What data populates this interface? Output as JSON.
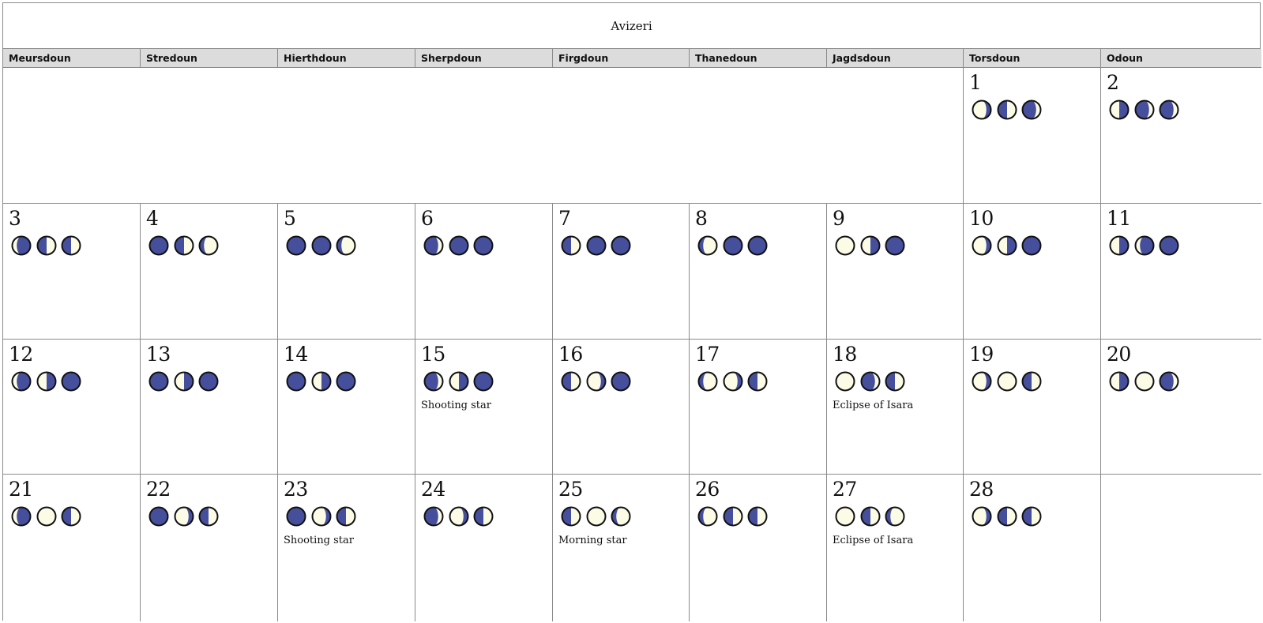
{
  "calendar": {
    "month": "Avizeri",
    "weekdays": [
      "Meursdoun",
      "Stredoun",
      "Hierthdoun",
      "Sherpdoun",
      "Firgdoun",
      "Thanedoun",
      "Jagdsdoun",
      "Torsdoun",
      "Odoun"
    ],
    "moon_colors": {
      "dark": "#454f9c",
      "light": "#fcfbe5",
      "outline": "#111111"
    },
    "moon_phase_encoding": [
      "new",
      "waxing-crescent",
      "first-quarter",
      "waxing-gibbous",
      "full",
      "waning-gibbous",
      "last-quarter",
      "waning-crescent"
    ],
    "days": [
      {
        "day": "1",
        "col": 7,
        "row": 0,
        "moons": [
          "waning-gibbous",
          "first-quarter",
          "waxing-crescent"
        ],
        "event": ""
      },
      {
        "day": "2",
        "col": 8,
        "row": 0,
        "moons": [
          "last-quarter",
          "waxing-crescent",
          "waxing-crescent"
        ],
        "event": ""
      },
      {
        "day": "3",
        "col": 0,
        "row": 1,
        "moons": [
          "waning-crescent",
          "first-quarter",
          "first-quarter"
        ],
        "event": ""
      },
      {
        "day": "4",
        "col": 1,
        "row": 1,
        "moons": [
          "new",
          "first-quarter",
          "waxing-gibbous"
        ],
        "event": ""
      },
      {
        "day": "5",
        "col": 2,
        "row": 1,
        "moons": [
          "new",
          "new",
          "waxing-gibbous"
        ],
        "event": ""
      },
      {
        "day": "6",
        "col": 3,
        "row": 1,
        "moons": [
          "waxing-crescent",
          "new",
          "new"
        ],
        "event": ""
      },
      {
        "day": "7",
        "col": 4,
        "row": 1,
        "moons": [
          "first-quarter",
          "new",
          "new"
        ],
        "event": ""
      },
      {
        "day": "8",
        "col": 5,
        "row": 1,
        "moons": [
          "waxing-gibbous",
          "new",
          "new"
        ],
        "event": ""
      },
      {
        "day": "9",
        "col": 6,
        "row": 1,
        "moons": [
          "full",
          "last-quarter",
          "new"
        ],
        "event": ""
      },
      {
        "day": "10",
        "col": 7,
        "row": 1,
        "moons": [
          "waning-gibbous",
          "last-quarter",
          "new"
        ],
        "event": ""
      },
      {
        "day": "11",
        "col": 8,
        "row": 1,
        "moons": [
          "last-quarter",
          "waning-crescent",
          "new"
        ],
        "event": ""
      },
      {
        "day": "12",
        "col": 0,
        "row": 2,
        "moons": [
          "waning-crescent",
          "last-quarter",
          "new"
        ],
        "event": ""
      },
      {
        "day": "13",
        "col": 1,
        "row": 2,
        "moons": [
          "new",
          "last-quarter",
          "new"
        ],
        "event": ""
      },
      {
        "day": "14",
        "col": 2,
        "row": 2,
        "moons": [
          "new",
          "last-quarter",
          "new"
        ],
        "event": ""
      },
      {
        "day": "15",
        "col": 3,
        "row": 2,
        "moons": [
          "waxing-crescent",
          "last-quarter",
          "new"
        ],
        "event": "Shooting star"
      },
      {
        "day": "16",
        "col": 4,
        "row": 2,
        "moons": [
          "first-quarter",
          "waning-gibbous",
          "new"
        ],
        "event": ""
      },
      {
        "day": "17",
        "col": 5,
        "row": 2,
        "moons": [
          "waxing-gibbous",
          "waning-gibbous",
          "first-quarter"
        ],
        "event": ""
      },
      {
        "day": "18",
        "col": 6,
        "row": 2,
        "moons": [
          "full",
          "waxing-crescent",
          "first-quarter"
        ],
        "event": "Eclipse of Isara"
      },
      {
        "day": "19",
        "col": 7,
        "row": 2,
        "moons": [
          "waning-gibbous",
          "full",
          "first-quarter"
        ],
        "event": ""
      },
      {
        "day": "20",
        "col": 8,
        "row": 2,
        "moons": [
          "last-quarter",
          "full",
          "waxing-crescent"
        ],
        "event": ""
      },
      {
        "day": "21",
        "col": 0,
        "row": 3,
        "moons": [
          "waning-crescent",
          "full",
          "first-quarter"
        ],
        "event": ""
      },
      {
        "day": "22",
        "col": 1,
        "row": 3,
        "moons": [
          "new",
          "waning-gibbous",
          "first-quarter"
        ],
        "event": ""
      },
      {
        "day": "23",
        "col": 2,
        "row": 3,
        "moons": [
          "new",
          "waning-gibbous",
          "first-quarter"
        ],
        "event": "Shooting star"
      },
      {
        "day": "24",
        "col": 3,
        "row": 3,
        "moons": [
          "waxing-crescent",
          "waning-gibbous",
          "first-quarter"
        ],
        "event": ""
      },
      {
        "day": "25",
        "col": 4,
        "row": 3,
        "moons": [
          "first-quarter",
          "full",
          "waxing-gibbous"
        ],
        "event": "Morning star"
      },
      {
        "day": "26",
        "col": 5,
        "row": 3,
        "moons": [
          "waxing-gibbous",
          "first-quarter",
          "first-quarter"
        ],
        "event": ""
      },
      {
        "day": "27",
        "col": 6,
        "row": 3,
        "moons": [
          "full",
          "first-quarter",
          "waxing-gibbous"
        ],
        "event": "Eclipse of Isara"
      },
      {
        "day": "28",
        "col": 7,
        "row": 3,
        "moons": [
          "waning-gibbous",
          "first-quarter",
          "first-quarter"
        ],
        "event": ""
      }
    ]
  }
}
